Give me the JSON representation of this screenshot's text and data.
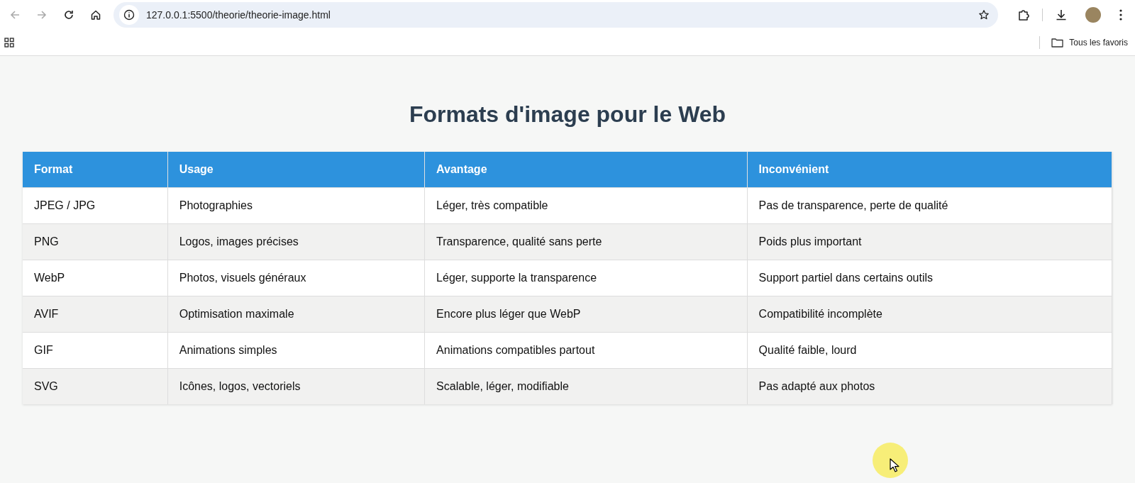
{
  "browser": {
    "nav_buttons": [
      {
        "kind": "back",
        "disabled": true
      },
      {
        "kind": "forward",
        "disabled": true
      },
      {
        "kind": "reload",
        "disabled": false
      },
      {
        "kind": "home",
        "disabled": false
      }
    ],
    "url": "127.0.0.1:5500/theorie/theorie-image.html",
    "bookmarks_folder": "Tous les favoris"
  },
  "page": {
    "title": "Formats d'image pour le Web",
    "table": {
      "columns": [
        "Format",
        "Usage",
        "Avantage",
        "Inconvénient"
      ],
      "rows": [
        [
          "JPEG / JPG",
          "Photographies",
          "Léger, très compatible",
          "Pas de transparence, perte de qualité"
        ],
        [
          "PNG",
          "Logos, images précises",
          "Transparence, qualité sans perte",
          "Poids plus important"
        ],
        [
          "WebP",
          "Photos, visuels généraux",
          "Léger, supporte la transparence",
          "Support partiel dans certains outils"
        ],
        [
          "AVIF",
          "Optimisation maximale",
          "Encore plus léger que WebP",
          "Compatibilité incomplète"
        ],
        [
          "GIF",
          "Animations simples",
          "Animations compatibles partout",
          "Qualité faible, lourd"
        ],
        [
          "SVG",
          "Icônes, logos, vectoriels",
          "Scalable, léger, modifiable",
          "Pas adapté aux photos"
        ]
      ]
    }
  }
}
